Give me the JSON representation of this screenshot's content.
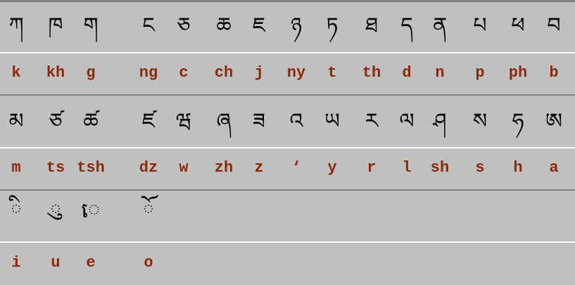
{
  "colors": {
    "background": "#c0c0c0",
    "tibetan_text": "#000000",
    "romanization_text": "#8b2a0a"
  },
  "rows": [
    {
      "tibetan": [
        "ཀ",
        "ཁ",
        "ག",
        "ང",
        "ཅ",
        "ཆ",
        "ཇ",
        "ཉ",
        "ཏ",
        "ཐ",
        "ད",
        "ན",
        "པ",
        "ཕ",
        "བ"
      ],
      "latin": [
        "k",
        "kh",
        "g",
        "ng",
        "c",
        "ch",
        "j",
        "ny",
        "t",
        "th",
        "d",
        "n",
        "p",
        "ph",
        "b"
      ]
    },
    {
      "tibetan": [
        "མ",
        "ཙ",
        "ཚ",
        "ཛ",
        "ཝ",
        "ཞ",
        "ཟ",
        "འ",
        "ཡ",
        "ར",
        "ལ",
        "ཤ",
        "ས",
        "ཧ",
        "ཨ"
      ],
      "latin": [
        "m",
        "ts",
        "tsh",
        "dz",
        "w",
        "zh",
        "z",
        "‘",
        "y",
        "r",
        "l",
        "sh",
        "s",
        "h",
        "a"
      ]
    },
    {
      "tibetan": [
        "◌ི",
        "◌ུ",
        "◌េ",
        "◌ོ"
      ],
      "latin": [
        "i",
        "u",
        "e",
        "o"
      ]
    }
  ]
}
